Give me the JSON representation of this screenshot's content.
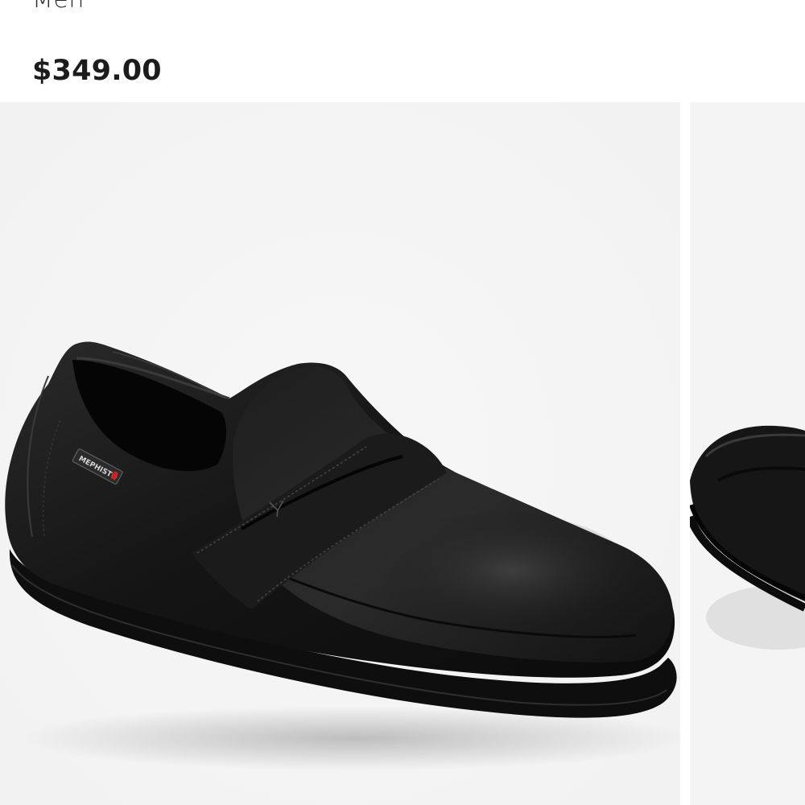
{
  "product": {
    "category": "Men",
    "price": "$349.00"
  },
  "gallery": {
    "main_image": "black-leather-penny-loafer",
    "logo_text": "MEPHISTO",
    "next_image": "black-leather-loafer-alternate-view",
    "colors": {
      "background": "#f4f4f4",
      "leather": "#151515",
      "sole": "#0e0e0e"
    }
  }
}
